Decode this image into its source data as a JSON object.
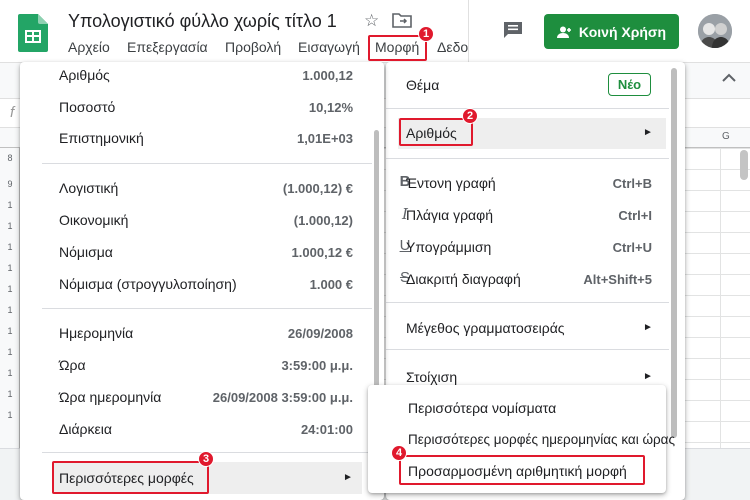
{
  "header": {
    "doc_title": "Υπολογιστικό φύλλο χωρίς τίτλο 1",
    "share_label": "Κοινή Χρήση",
    "menubar": [
      "Αρχείο",
      "Επεξεργασία",
      "Προβολή",
      "Εισαγωγή",
      "Μορφή",
      "Δεδο"
    ]
  },
  "sheet": {
    "col_g": "G",
    "rows": [
      "8",
      "9",
      "1",
      "1",
      "1",
      "1",
      "1",
      "1",
      "1",
      "1",
      "1",
      "1",
      "1",
      "2",
      "2"
    ]
  },
  "format_menu": {
    "theme_label": "Θέμα",
    "new_badge": "Νέο",
    "number_label": "Αριθμός",
    "bold_label": "Έντονη γραφή",
    "bold_shortcut": "Ctrl+B",
    "italic_label": "Πλάγια γραφή",
    "italic_shortcut": "Ctrl+I",
    "underline_label": "Υπογράμμιση",
    "underline_shortcut": "Ctrl+U",
    "strike_label": "Διακριτή διαγραφή",
    "strike_shortcut": "Alt+Shift+5",
    "font_size_label": "Μέγεθος γραμματοσειράς",
    "align_label": "Στοίχιση",
    "icon_bold": "B",
    "icon_italic": "I",
    "icon_underline": "U",
    "icon_strike": "S"
  },
  "number_menu": {
    "group1": [
      {
        "label": "Αριθμός",
        "value": "1.000,12"
      },
      {
        "label": "Ποσοστό",
        "value": "10,12%"
      },
      {
        "label": "Επιστημονική",
        "value": "1,01E+03"
      }
    ],
    "group2": [
      {
        "label": "Λογιστική",
        "value": "(1.000,12) €"
      },
      {
        "label": "Οικονομική",
        "value": "(1.000,12)"
      },
      {
        "label": "Νόμισμα",
        "value": "1.000,12 €"
      },
      {
        "label": "Νόμισμα (στρογγυλοποίηση)",
        "value": "1.000 €"
      }
    ],
    "group3": [
      {
        "label": "Ημερομηνία",
        "value": "26/09/2008"
      },
      {
        "label": "Ώρα",
        "value": "3:59:00 μ.μ."
      },
      {
        "label": "Ώρα ημερομηνία",
        "value": "26/09/2008 3:59:00 μ.μ."
      },
      {
        "label": "Διάρκεια",
        "value": "24:01:00"
      }
    ],
    "more_formats_label": "Περισσότερες μορφές"
  },
  "more_menu": {
    "currencies": "Περισσότερα νομίσματα",
    "date_time": "Περισσότερες μορφές ημερομηνίας και ώρας",
    "custom_number": "Προσαρμοσμένη αριθμητική μορφή"
  },
  "badges": [
    "1",
    "2",
    "3",
    "4"
  ],
  "colors": {
    "accent_green": "#1e8e3e",
    "highlight_red": "#e0192d"
  }
}
